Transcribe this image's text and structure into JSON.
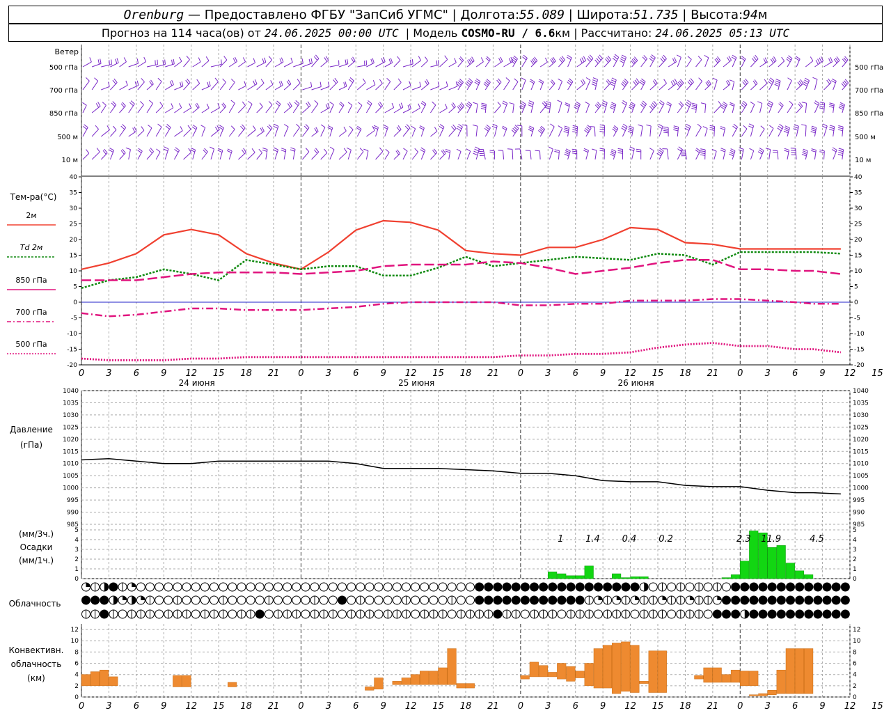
{
  "header": {
    "city": "Orenburg",
    "dash": " — ",
    "provider": "Предоставлено ФГБУ \"ЗапСиб УГМС\"",
    "lon_label": "Долгота:",
    "lon": "55.089",
    "lat_label": "Широта:",
    "lat": "51.735",
    "alt_label": "Высота:",
    "alt": "94",
    "alt_unit": "м",
    "sep": " | ",
    "forecast_prefix": "Прогноз на 114 часа(ов) от ",
    "forecast_from": "24.06.2025 00:00 UTC",
    "model_label": "  | Модель ",
    "model": "COSMO-RU / 6.6",
    "model_unit": "км",
    "calc_label": " | Рассчитано: ",
    "calc_time": "24.06.2025 05:13 UTC"
  },
  "colors": {
    "wind": "#7a28c8",
    "t2m": "#f04030",
    "td2m": "#108a10",
    "t850": "#e0147e",
    "t700": "#e0147e",
    "t500": "#e0147e",
    "pressure": "#000000",
    "precip": "#12d612",
    "conv": "#ee8a30",
    "zero_line": "#2020c8",
    "grid": "#aaaaaa"
  },
  "x_axis": {
    "hour_labels": [
      "0",
      "3",
      "6",
      "9",
      "12",
      "15",
      "18",
      "21",
      "0",
      "3",
      "6",
      "9",
      "12",
      "15",
      "18",
      "21",
      "0",
      "3",
      "6",
      "9",
      "12",
      "15",
      "18",
      "21",
      "0",
      "3",
      "6",
      "9",
      "12",
      "15",
      "18",
      "21",
      "0",
      "3",
      "6"
    ],
    "day_labels": [
      {
        "text": "24 июня",
        "hour": 12
      },
      {
        "text": "25 июня",
        "hour": 36
      },
      {
        "text": "26 июня",
        "hour": 60
      }
    ]
  },
  "wind_panel": {
    "title": "Ветер",
    "levels": [
      "500 гПа",
      "700 гПа",
      "850 гПа",
      "500  м",
      "10   м"
    ]
  },
  "temperature_panel": {
    "title": "Тем-ра(°C)",
    "legend": [
      "2м",
      "Td 2м",
      "850 гПа",
      "700 гПа",
      "500 гПа"
    ],
    "y_ticks": [
      "40",
      "35",
      "30",
      "25",
      "20",
      "15",
      "10",
      "5",
      "0",
      "-5",
      "-10",
      "-15",
      "-20"
    ]
  },
  "pressure_panel": {
    "title_line1": "Давление",
    "title_line2": "(гПа)",
    "y_ticks": [
      "1040",
      "1035",
      "1030",
      "1025",
      "1020",
      "1015",
      "1010",
      "1005",
      "1000",
      "995",
      "990",
      "985"
    ]
  },
  "precip_panel": {
    "title_line1": "(мм/3ч.)",
    "title_line2": "Осадки",
    "title_line3": "(мм/1ч.)",
    "y_ticks": [
      "5",
      "4",
      "3",
      "2",
      "1",
      "0"
    ],
    "totals": [
      "1",
      "1.4",
      "0.4",
      "0.2",
      "2.3",
      "11.9",
      "4.5"
    ]
  },
  "cloud_panel": {
    "title": "Облачность"
  },
  "conv_panel": {
    "title_line1": "Конвективн.",
    "title_line2": "облачность",
    "title_line3": "(км)",
    "y_ticks": [
      "12",
      "10",
      "8",
      "6",
      "4",
      "2",
      "0"
    ]
  },
  "chart_data": [
    {
      "type": "line",
      "title": "Тем-ра(°C)",
      "x_unit": "hours from 24.06.2025 00:00 UTC",
      "ylim": [
        -20,
        40
      ],
      "series": [
        {
          "name": "2м",
          "x": [
            0,
            3,
            6,
            9,
            12,
            15,
            18,
            21,
            24,
            27,
            30,
            33,
            36,
            39,
            42,
            45,
            48,
            51,
            54,
            57,
            60,
            63,
            66,
            69,
            72,
            75,
            78,
            80,
            83
          ],
          "values": [
            10.5,
            12.5,
            15.5,
            21.5,
            23.2,
            21.5,
            15.5,
            12.5,
            10.5,
            16,
            23,
            26,
            25.5,
            23,
            16.5,
            15.5,
            15,
            17.5,
            17.5,
            20,
            23.8,
            23.2,
            19,
            18.5,
            17,
            17,
            17,
            17,
            17
          ]
        },
        {
          "name": "Td 2м",
          "x": [
            0,
            3,
            6,
            9,
            12,
            15,
            18,
            21,
            24,
            27,
            30,
            33,
            36,
            39,
            42,
            45,
            48,
            51,
            54,
            57,
            60,
            63,
            66,
            69,
            72,
            75,
            78,
            80,
            83
          ],
          "values": [
            4.5,
            7,
            8,
            10.5,
            9,
            7,
            13.5,
            12,
            10.5,
            11.5,
            11.5,
            8.5,
            8.5,
            11,
            14.5,
            11.5,
            12.5,
            13.5,
            14.5,
            14,
            13.5,
            15.5,
            15,
            12,
            16,
            16,
            16,
            16,
            15.5
          ]
        },
        {
          "name": "850 гПа",
          "x": [
            0,
            3,
            6,
            9,
            12,
            15,
            18,
            21,
            24,
            27,
            30,
            33,
            36,
            39,
            42,
            45,
            48,
            51,
            54,
            57,
            60,
            63,
            66,
            69,
            72,
            75,
            78,
            80,
            83
          ],
          "values": [
            7,
            7,
            7,
            8,
            9,
            9.5,
            9.5,
            9.5,
            9,
            9.5,
            10,
            11.5,
            12,
            12,
            12,
            13,
            12.5,
            11,
            9,
            10,
            11,
            12.5,
            13.5,
            13.5,
            10.5,
            10.5,
            10,
            10,
            9
          ]
        },
        {
          "name": "700 гПа",
          "x": [
            0,
            3,
            6,
            9,
            12,
            15,
            18,
            21,
            24,
            27,
            30,
            33,
            36,
            39,
            42,
            45,
            48,
            51,
            54,
            57,
            60,
            63,
            66,
            69,
            72,
            75,
            78,
            80,
            83
          ],
          "values": [
            -3.5,
            -4.5,
            -4,
            -3,
            -2,
            -2,
            -2.5,
            -2.5,
            -2.5,
            -2,
            -1.5,
            -0.5,
            0,
            0,
            0,
            0,
            -1,
            -1,
            -0.5,
            -0.5,
            0.5,
            0.5,
            0.5,
            1,
            1,
            0.5,
            0,
            -0.5,
            -0.5
          ]
        },
        {
          "name": "500 гПа",
          "x": [
            0,
            3,
            6,
            9,
            12,
            15,
            18,
            21,
            24,
            27,
            30,
            33,
            36,
            39,
            42,
            45,
            48,
            51,
            54,
            57,
            60,
            63,
            66,
            69,
            72,
            75,
            78,
            80,
            83
          ],
          "values": [
            -18,
            -18.5,
            -18.5,
            -18.5,
            -18,
            -18,
            -17.5,
            -17.5,
            -17.5,
            -17.5,
            -17.5,
            -17.5,
            -17.5,
            -17.5,
            -17.5,
            -17.5,
            -17,
            -17,
            -16.5,
            -16.5,
            -16,
            -14.5,
            -13.5,
            -13,
            -14,
            -14,
            -15,
            -15,
            -16
          ]
        }
      ]
    },
    {
      "type": "line",
      "title": "Давление",
      "ylabel": "(гПа)",
      "ylim": [
        985,
        1040
      ],
      "series": [
        {
          "name": "Давление",
          "x": [
            0,
            3,
            6,
            9,
            12,
            15,
            18,
            21,
            24,
            27,
            30,
            33,
            36,
            39,
            42,
            45,
            48,
            51,
            54,
            57,
            60,
            63,
            66,
            69,
            72,
            75,
            78,
            80,
            83
          ],
          "values": [
            1011.5,
            1012,
            1011,
            1010,
            1010,
            1011,
            1011,
            1011,
            1011,
            1011,
            1010,
            1008,
            1008,
            1008,
            1007.5,
            1007,
            1006,
            1006,
            1005,
            1003,
            1002.5,
            1002.5,
            1001,
            1000.5,
            1000.5,
            999,
            998,
            998,
            997.5
          ]
        }
      ]
    },
    {
      "type": "bar",
      "title": "Осадки",
      "ylabel": "(мм/3ч.) / (мм/1ч.)",
      "ylim": [
        0,
        5
      ],
      "x": [
        51,
        52,
        53,
        54,
        55,
        56,
        57,
        58,
        59,
        60,
        61,
        62,
        63,
        70,
        71,
        72,
        73,
        74,
        75,
        76,
        77,
        78,
        79,
        80,
        81,
        82
      ],
      "values": [
        0.7,
        0.5,
        0.3,
        0.3,
        1.3,
        0,
        0,
        0.5,
        0.1,
        0.2,
        0.2,
        0,
        0,
        0.1,
        0.4,
        1.8,
        4.9,
        4.7,
        3.2,
        3.4,
        1.6,
        0.8,
        0.4,
        0,
        0,
        0
      ],
      "totals": [
        "1",
        "1.4",
        "0.4",
        "0.2",
        "2.3",
        "11.9",
        "4.5"
      ]
    },
    {
      "type": "bar",
      "title": "Конвективн. облачность",
      "ylabel": "(км)",
      "ylim": [
        0,
        13
      ],
      "bars": [
        {
          "x0": 0,
          "x1": 1,
          "lo": 2.0,
          "hi": 4.0
        },
        {
          "x0": 1,
          "x1": 2,
          "lo": 2.0,
          "hi": 4.5
        },
        {
          "x0": 2,
          "x1": 3,
          "lo": 2.0,
          "hi": 4.8
        },
        {
          "x0": 3,
          "x1": 4,
          "lo": 2.0,
          "hi": 3.6
        },
        {
          "x0": 10,
          "x1": 11,
          "lo": 1.8,
          "hi": 3.8
        },
        {
          "x0": 11,
          "x1": 12,
          "lo": 1.8,
          "hi": 3.8
        },
        {
          "x0": 16,
          "x1": 17,
          "lo": 1.8,
          "hi": 2.6
        },
        {
          "x0": 31,
          "x1": 32,
          "lo": 1.2,
          "hi": 1.8
        },
        {
          "x0": 32,
          "x1": 33,
          "lo": 1.4,
          "hi": 3.4
        },
        {
          "x0": 34,
          "x1": 35,
          "lo": 2.2,
          "hi": 2.8
        },
        {
          "x0": 35,
          "x1": 36,
          "lo": 2.2,
          "hi": 3.4
        },
        {
          "x0": 36,
          "x1": 37,
          "lo": 2.2,
          "hi": 4.0
        },
        {
          "x0": 37,
          "x1": 38,
          "lo": 2.2,
          "hi": 4.6
        },
        {
          "x0": 38,
          "x1": 39,
          "lo": 2.2,
          "hi": 4.6
        },
        {
          "x0": 39,
          "x1": 40,
          "lo": 2.2,
          "hi": 5.2
        },
        {
          "x0": 40,
          "x1": 41,
          "lo": 2.2,
          "hi": 8.6
        },
        {
          "x0": 41,
          "x1": 42,
          "lo": 1.6,
          "hi": 2.4
        },
        {
          "x0": 42,
          "x1": 43,
          "lo": 1.6,
          "hi": 2.4
        },
        {
          "x0": 48,
          "x1": 49,
          "lo": 3.2,
          "hi": 3.8
        },
        {
          "x0": 49,
          "x1": 50,
          "lo": 3.6,
          "hi": 6.2
        },
        {
          "x0": 50,
          "x1": 51,
          "lo": 3.6,
          "hi": 5.6
        },
        {
          "x0": 51,
          "x1": 52,
          "lo": 3.6,
          "hi": 4.4
        },
        {
          "x0": 52,
          "x1": 53,
          "lo": 3.2,
          "hi": 6.0
        },
        {
          "x0": 53,
          "x1": 54,
          "lo": 2.8,
          "hi": 5.4
        },
        {
          "x0": 54,
          "x1": 55,
          "lo": 3.4,
          "hi": 4.6
        },
        {
          "x0": 55,
          "x1": 56,
          "lo": 2.0,
          "hi": 6.0
        },
        {
          "x0": 56,
          "x1": 57,
          "lo": 1.6,
          "hi": 8.6
        },
        {
          "x0": 57,
          "x1": 58,
          "lo": 1.6,
          "hi": 9.2
        },
        {
          "x0": 58,
          "x1": 59,
          "lo": 0.6,
          "hi": 9.6
        },
        {
          "x0": 59,
          "x1": 60,
          "lo": 1.0,
          "hi": 9.8
        },
        {
          "x0": 60,
          "x1": 61,
          "lo": 0.8,
          "hi": 9.2
        },
        {
          "x0": 61,
          "x1": 62,
          "lo": 2.4,
          "hi": 2.8
        },
        {
          "x0": 62,
          "x1": 63,
          "lo": 0.8,
          "hi": 8.2
        },
        {
          "x0": 63,
          "x1": 64,
          "lo": 0.8,
          "hi": 8.2
        },
        {
          "x0": 67,
          "x1": 68,
          "lo": 3.2,
          "hi": 3.8
        },
        {
          "x0": 68,
          "x1": 69,
          "lo": 2.6,
          "hi": 5.2
        },
        {
          "x0": 69,
          "x1": 70,
          "lo": 2.6,
          "hi": 5.2
        },
        {
          "x0": 70,
          "x1": 71,
          "lo": 2.6,
          "hi": 4.0
        },
        {
          "x0": 71,
          "x1": 72,
          "lo": 2.6,
          "hi": 4.8
        },
        {
          "x0": 72,
          "x1": 73,
          "lo": 2.0,
          "hi": 4.6
        },
        {
          "x0": 73,
          "x1": 74,
          "lo": 2.0,
          "hi": 4.6
        },
        {
          "x0": 73,
          "x1": 74,
          "lo": 0.2,
          "hi": 0.4
        },
        {
          "x0": 74,
          "x1": 75,
          "lo": 0.2,
          "hi": 0.6
        },
        {
          "x0": 75,
          "x1": 76,
          "lo": 0.4,
          "hi": 1.2
        },
        {
          "x0": 76,
          "x1": 77,
          "lo": 0.6,
          "hi": 4.8
        },
        {
          "x0": 77,
          "x1": 78,
          "lo": 0.6,
          "hi": 8.6
        },
        {
          "x0": 78,
          "x1": 79,
          "lo": 0.6,
          "hi": 8.6
        },
        {
          "x0": 79,
          "x1": 80,
          "lo": 0.6,
          "hi": 8.6
        }
      ]
    }
  ]
}
